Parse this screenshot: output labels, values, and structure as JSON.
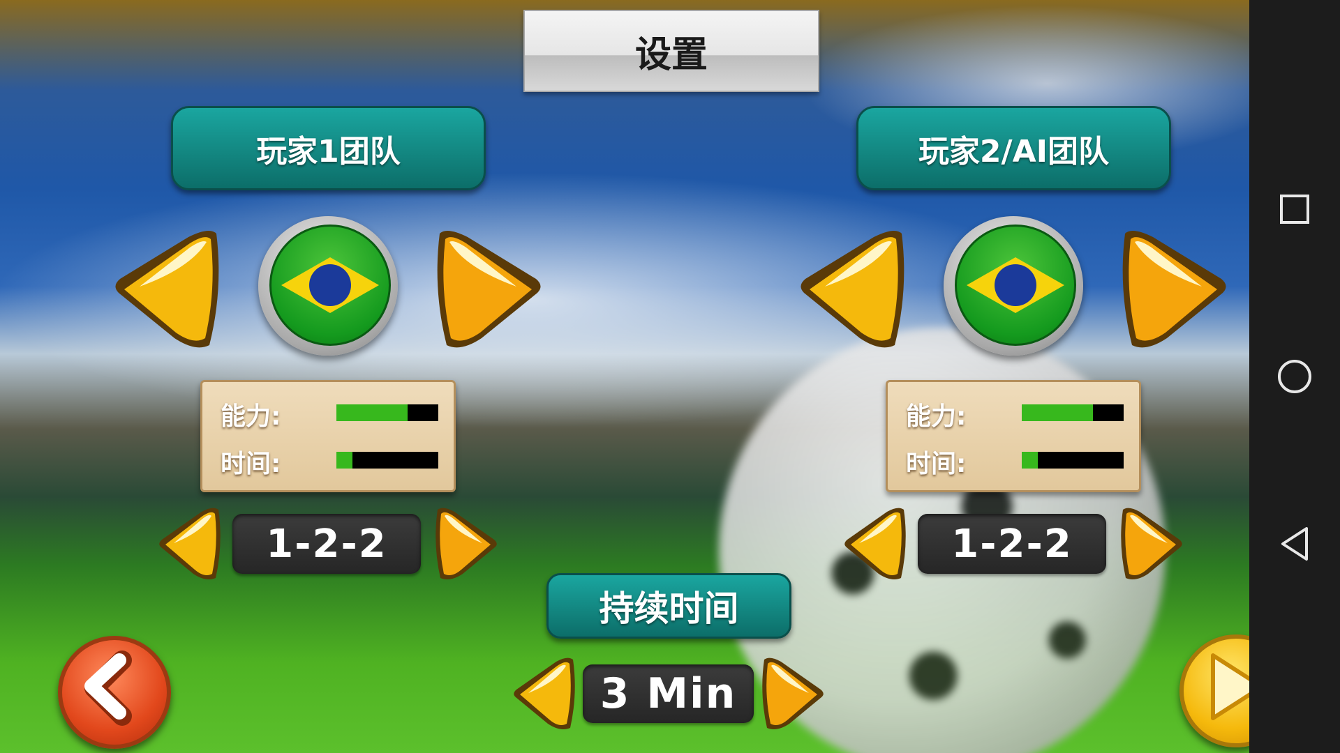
{
  "title": "设置",
  "player1": {
    "header": "玩家1团队",
    "flag": "brazil-flag-icon",
    "stats": {
      "ability_label": "能力:",
      "ability_level": 0.7,
      "time_label": "时间:",
      "time_level": 0.16
    },
    "formation": "1-2-2"
  },
  "player2": {
    "header": "玩家2/AI团队",
    "flag": "brazil-flag-icon",
    "stats": {
      "ability_label": "能力:",
      "ability_level": 0.7,
      "time_label": "时间:",
      "time_level": 0.16
    },
    "formation": "1-2-2"
  },
  "duration": {
    "header": "持续时间",
    "value": "3 Min"
  },
  "colors": {
    "teal": "#138781",
    "arrow_yellow": "#f5b90c",
    "back_red": "#e2481c",
    "bar_green": "#37b81d"
  },
  "icons": {
    "back": "back-chevron-icon",
    "next": "play-icon",
    "nav": [
      "square-icon",
      "circle-icon",
      "triangle-back-icon"
    ]
  }
}
